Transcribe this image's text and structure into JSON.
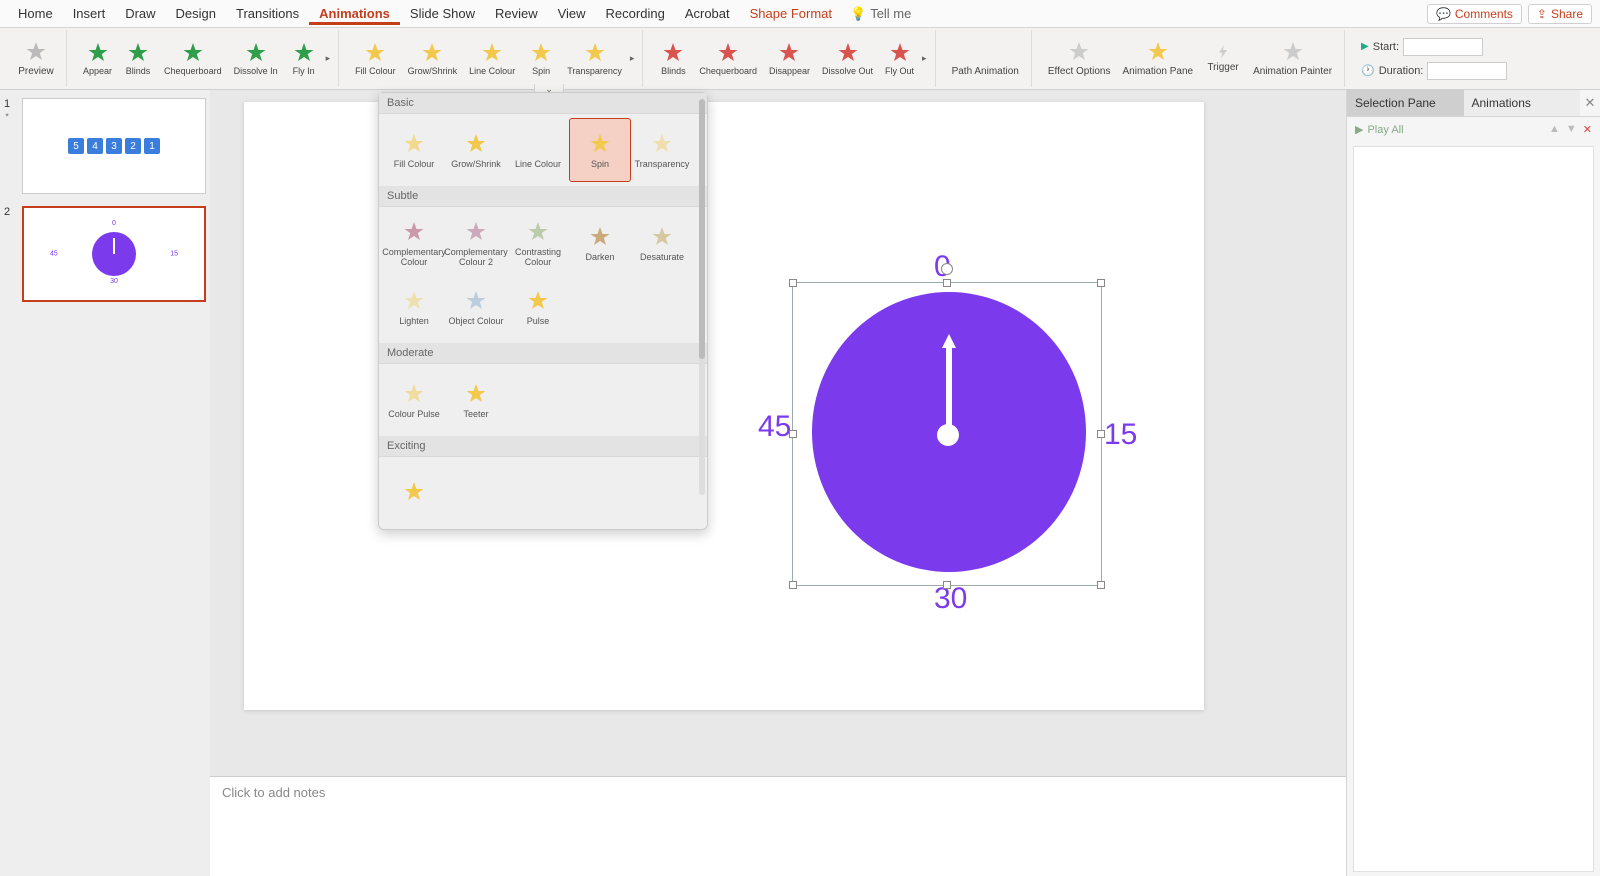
{
  "menu": {
    "tabs": [
      "Home",
      "Insert",
      "Draw",
      "Design",
      "Transitions",
      "Animations",
      "Slide Show",
      "Review",
      "View",
      "Recording",
      "Acrobat",
      "Shape Format"
    ],
    "active": "Animations",
    "shape_format": "Shape Format",
    "tell_me": "Tell me",
    "comments": "Comments",
    "share": "Share"
  },
  "ribbon": {
    "preview": "Preview",
    "entrance": [
      "Appear",
      "Blinds",
      "Chequerboard",
      "Dissolve In",
      "Fly In"
    ],
    "emphasis": [
      "Fill Colour",
      "Grow/Shrink",
      "Line Colour",
      "Spin",
      "Transparency"
    ],
    "exit": [
      "Blinds",
      "Chequerboard",
      "Disappear",
      "Dissolve Out",
      "Fly Out"
    ],
    "path": "Path Animation",
    "effect_options": "Effect Options",
    "animation_pane": "Animation Pane",
    "trigger": "Trigger",
    "painter": "Animation Painter",
    "start_label": "Start:",
    "duration_label": "Duration:",
    "start_value": "",
    "duration_value": ""
  },
  "thumbs": {
    "slide1_boxes": [
      "5",
      "4",
      "3",
      "2",
      "1"
    ],
    "slide2_labels": {
      "top": "0",
      "right": "15",
      "bottom": "30",
      "left": "45"
    }
  },
  "slide": {
    "labels": {
      "top": "0",
      "right": "15",
      "bottom": "30",
      "left": "45"
    }
  },
  "notes_placeholder": "Click to add notes",
  "emph_dropdown": {
    "categories": {
      "basic": {
        "title": "Basic",
        "items": [
          "Fill Colour",
          "Grow/Shrink",
          "Line Colour",
          "Spin",
          "Transparency"
        ],
        "selected": "Spin"
      },
      "subtle": {
        "title": "Subtle",
        "items": [
          "Complementary Colour",
          "Complementary Colour 2",
          "Contrasting Colour",
          "Darken",
          "Desaturate",
          "Lighten",
          "Object Colour",
          "Pulse"
        ]
      },
      "moderate": {
        "title": "Moderate",
        "items": [
          "Colour Pulse",
          "Teeter"
        ]
      },
      "exciting": {
        "title": "Exciting",
        "items": [
          ""
        ]
      }
    }
  },
  "right_pane": {
    "tab_selection": "Selection Pane",
    "tab_animations": "Animations",
    "play_all": "Play All"
  }
}
